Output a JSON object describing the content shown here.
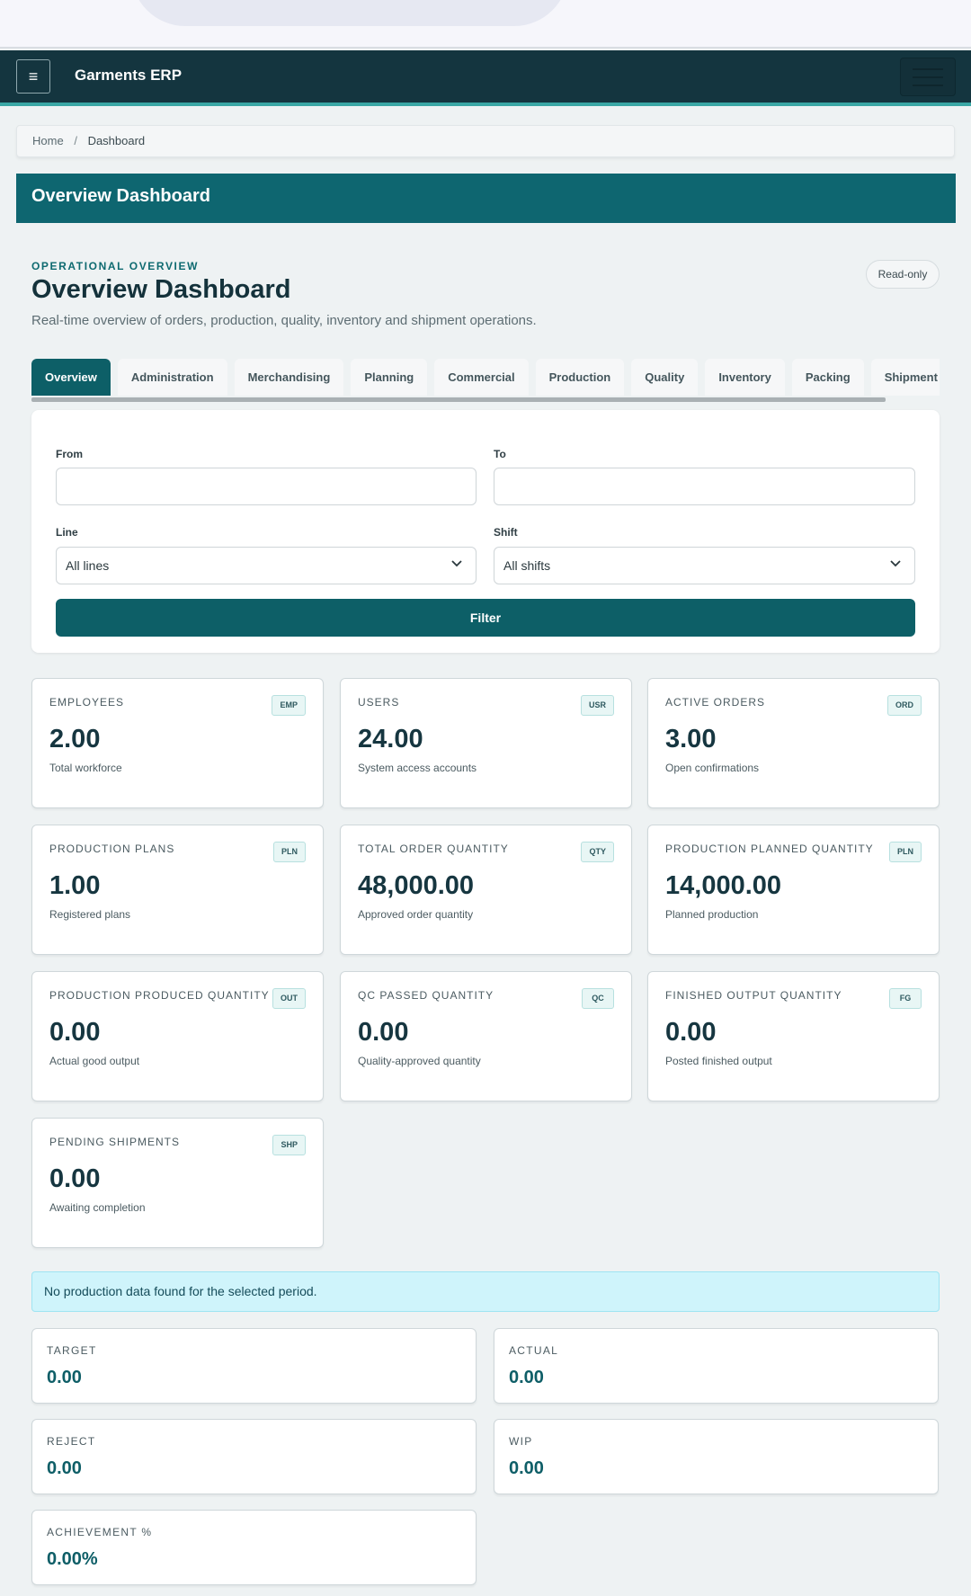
{
  "navbar": {
    "toggle_icon": "≡",
    "brand": "Garments ERP"
  },
  "breadcrumb": {
    "home": "Home",
    "separator": "/",
    "current": "Dashboard"
  },
  "banner": {
    "title": "Overview Dashboard"
  },
  "header": {
    "eyebrow": "OPERATIONAL OVERVIEW",
    "title": "Overview Dashboard",
    "subtitle": "Real-time overview of orders, production, quality, inventory and shipment operations.",
    "badge": "Read-only"
  },
  "tabs": [
    "Overview",
    "Administration",
    "Merchandising",
    "Planning",
    "Commercial",
    "Production",
    "Quality",
    "Inventory",
    "Packing",
    "Shipment",
    ""
  ],
  "filters": {
    "from_label": "From",
    "from_value": "",
    "to_label": "To",
    "to_value": "",
    "line_label": "Line",
    "line_value": "All lines",
    "shift_label": "Shift",
    "shift_value": "All shifts",
    "button": "Filter"
  },
  "kpis": [
    {
      "label": "EMPLOYEES",
      "code": "EMP",
      "value": "2.00",
      "desc": "Total workforce"
    },
    {
      "label": "USERS",
      "code": "USR",
      "value": "24.00",
      "desc": "System access accounts"
    },
    {
      "label": "ACTIVE ORDERS",
      "code": "ORD",
      "value": "3.00",
      "desc": "Open confirmations"
    },
    {
      "label": "PRODUCTION PLANS",
      "code": "PLN",
      "value": "1.00",
      "desc": "Registered plans"
    },
    {
      "label": "TOTAL ORDER QUANTITY",
      "code": "QTY",
      "value": "48,000.00",
      "desc": "Approved order quantity"
    },
    {
      "label": "PRODUCTION PLANNED QUANTITY",
      "code": "PLN",
      "value": "14,000.00",
      "desc": "Planned production"
    },
    {
      "label": "PRODUCTION PRODUCED QUANTITY",
      "code": "OUT",
      "value": "0.00",
      "desc": "Actual good output"
    },
    {
      "label": "QC PASSED QUANTITY",
      "code": "QC",
      "value": "0.00",
      "desc": "Quality-approved quantity"
    },
    {
      "label": "FINISHED OUTPUT QUANTITY",
      "code": "FG",
      "value": "0.00",
      "desc": "Posted finished output"
    },
    {
      "label": "PENDING SHIPMENTS",
      "code": "SHP",
      "value": "0.00",
      "desc": "Awaiting completion"
    }
  ],
  "alert": {
    "text": "No production data found for the selected period."
  },
  "stats": [
    {
      "label": "TARGET",
      "value": "0.00"
    },
    {
      "label": "ACTUAL",
      "value": "0.00"
    },
    {
      "label": "REJECT",
      "value": "0.00"
    },
    {
      "label": "WIP",
      "value": "0.00"
    },
    {
      "label": "ACHIEVEMENT %",
      "value": "0.00%"
    }
  ]
}
